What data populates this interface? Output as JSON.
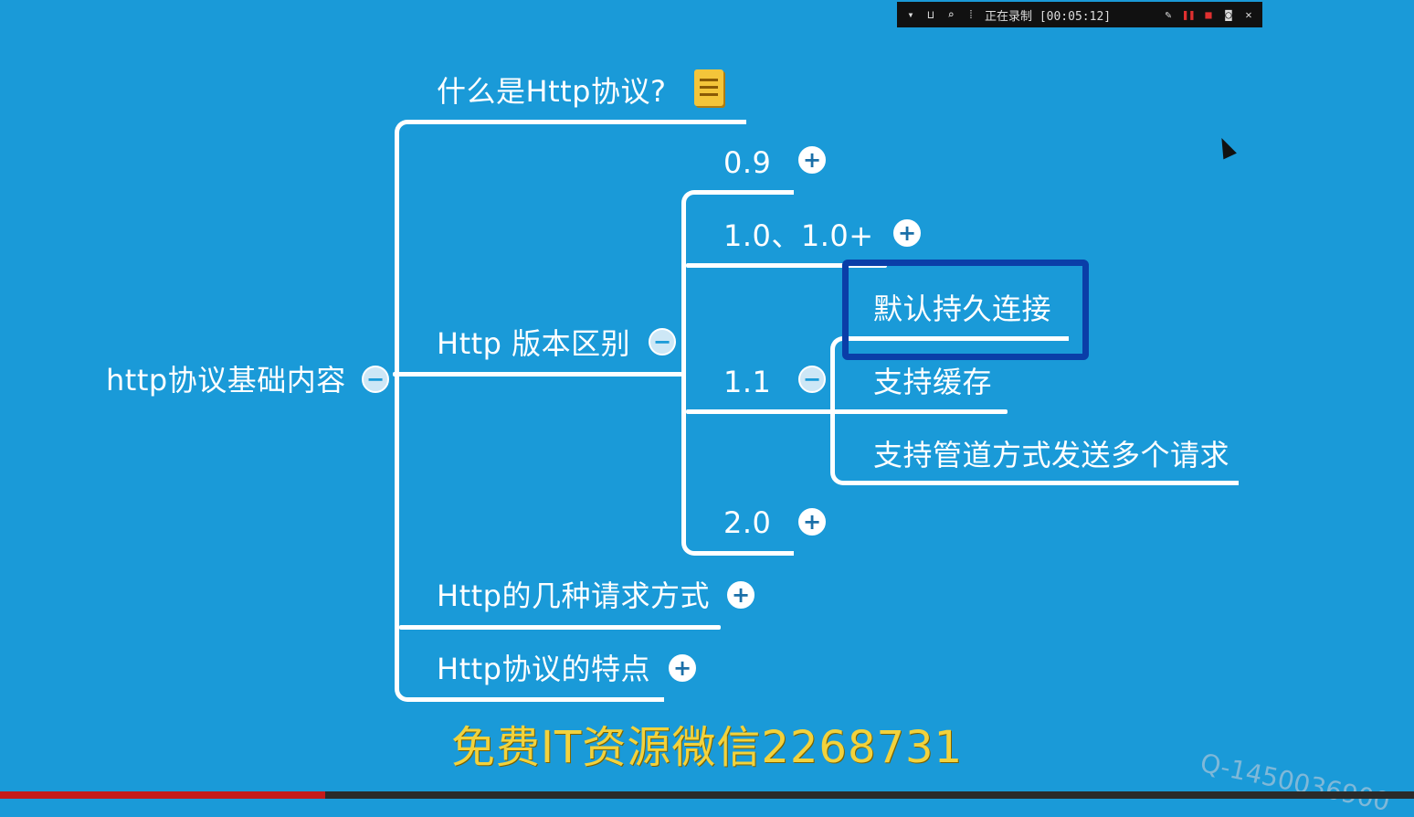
{
  "mindmap": {
    "root": {
      "label": "http协议基础内容",
      "toggle": "−"
    },
    "branches": [
      {
        "label": "什么是Http协议?",
        "icon": "note-icon"
      },
      {
        "label": "Http 版本区别",
        "toggle": "−"
      },
      {
        "label": "Http的几种请求方式",
        "toggle": "+"
      },
      {
        "label": "Http协议的特点",
        "toggle": "+"
      }
    ],
    "versions": [
      {
        "label": "0.9",
        "toggle": "+"
      },
      {
        "label": "1.0、1.0+",
        "toggle": "+"
      },
      {
        "label": "1.1",
        "toggle": "−"
      },
      {
        "label": "2.0",
        "toggle": "+"
      }
    ],
    "v11_children": [
      {
        "label": "默认持久连接",
        "highlighted": true
      },
      {
        "label": "支持缓存"
      },
      {
        "label": "支持管道方式发送多个请求"
      }
    ]
  },
  "recorder_toolbar": {
    "status": "正在录制 [00:05:12]",
    "icons": [
      "dropdown-icon",
      "window-icon",
      "zoom-icon",
      "dots-icon",
      "pen-icon",
      "pause-icon",
      "stop-icon",
      "camera-icon",
      "close-icon"
    ]
  },
  "watermark": "免费IT资源微信2268731",
  "qq_watermark": "Q-1450036900",
  "colors": {
    "background": "#1a9ad8",
    "line": "#ffffff",
    "highlight_border": "#0a3ea8",
    "watermark_text": "#f2d23c"
  },
  "video_progress": 0.23
}
